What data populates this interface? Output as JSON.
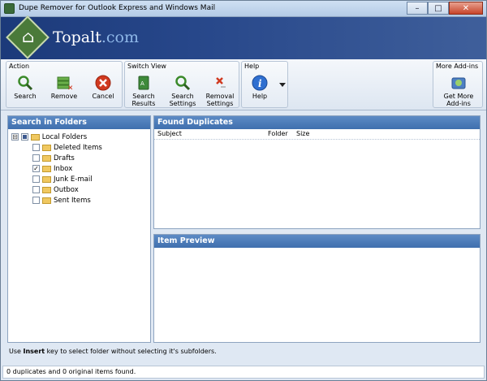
{
  "window": {
    "title": "Dupe Remover for Outlook Express and Windows Mail",
    "controls": {
      "minimize": "–",
      "maximize": "□",
      "close": "✕"
    }
  },
  "banner": {
    "brand": "Topalt",
    "domain": ".com"
  },
  "ribbon": {
    "groups": [
      {
        "title": "Action",
        "buttons": [
          {
            "label": "Search",
            "icon": "magnifier-icon"
          },
          {
            "label": "Remove",
            "icon": "stack-remove-icon"
          },
          {
            "label": "Cancel",
            "icon": "red-x-icon"
          }
        ]
      },
      {
        "title": "Switch View",
        "buttons": [
          {
            "label1": "Search",
            "label2": "Results",
            "icon": "results-book-icon"
          },
          {
            "label1": "Search",
            "label2": "Settings",
            "icon": "magnifier-icon"
          },
          {
            "label1": "Removal",
            "label2": "Settings",
            "icon": "red-x-icon"
          }
        ]
      },
      {
        "title": "Help",
        "buttons": [
          {
            "label": "Help",
            "icon": "info-icon"
          }
        ]
      },
      {
        "title": "More Add-ins",
        "buttons": [
          {
            "label1": "Get More",
            "label2": "Add-ins",
            "icon": "addins-icon"
          }
        ]
      }
    ]
  },
  "folders_panel": {
    "title": "Search in Folders",
    "root": {
      "label": "Local Folders",
      "expander": "⊟"
    },
    "items": [
      {
        "label": "Deleted Items",
        "checked": false
      },
      {
        "label": "Drafts",
        "checked": false
      },
      {
        "label": "Inbox",
        "checked": true,
        "mark": "✓"
      },
      {
        "label": "Junk E-mail",
        "checked": false
      },
      {
        "label": "Outbox",
        "checked": false
      },
      {
        "label": "Sent Items",
        "checked": false
      }
    ]
  },
  "duplicates_panel": {
    "title": "Found Duplicates",
    "columns": [
      "Subject",
      "Folder",
      "Size"
    ]
  },
  "preview_panel": {
    "title": "Item Preview"
  },
  "hint": {
    "prefix": "Use ",
    "key": "Insert",
    "suffix": " key to select folder without selecting it's subfolders."
  },
  "status": {
    "text": "0 duplicates and 0 original items found."
  },
  "colors": {
    "accent": "#3f6fae",
    "banner": "#1c3a7a",
    "danger": "#d0391f"
  }
}
